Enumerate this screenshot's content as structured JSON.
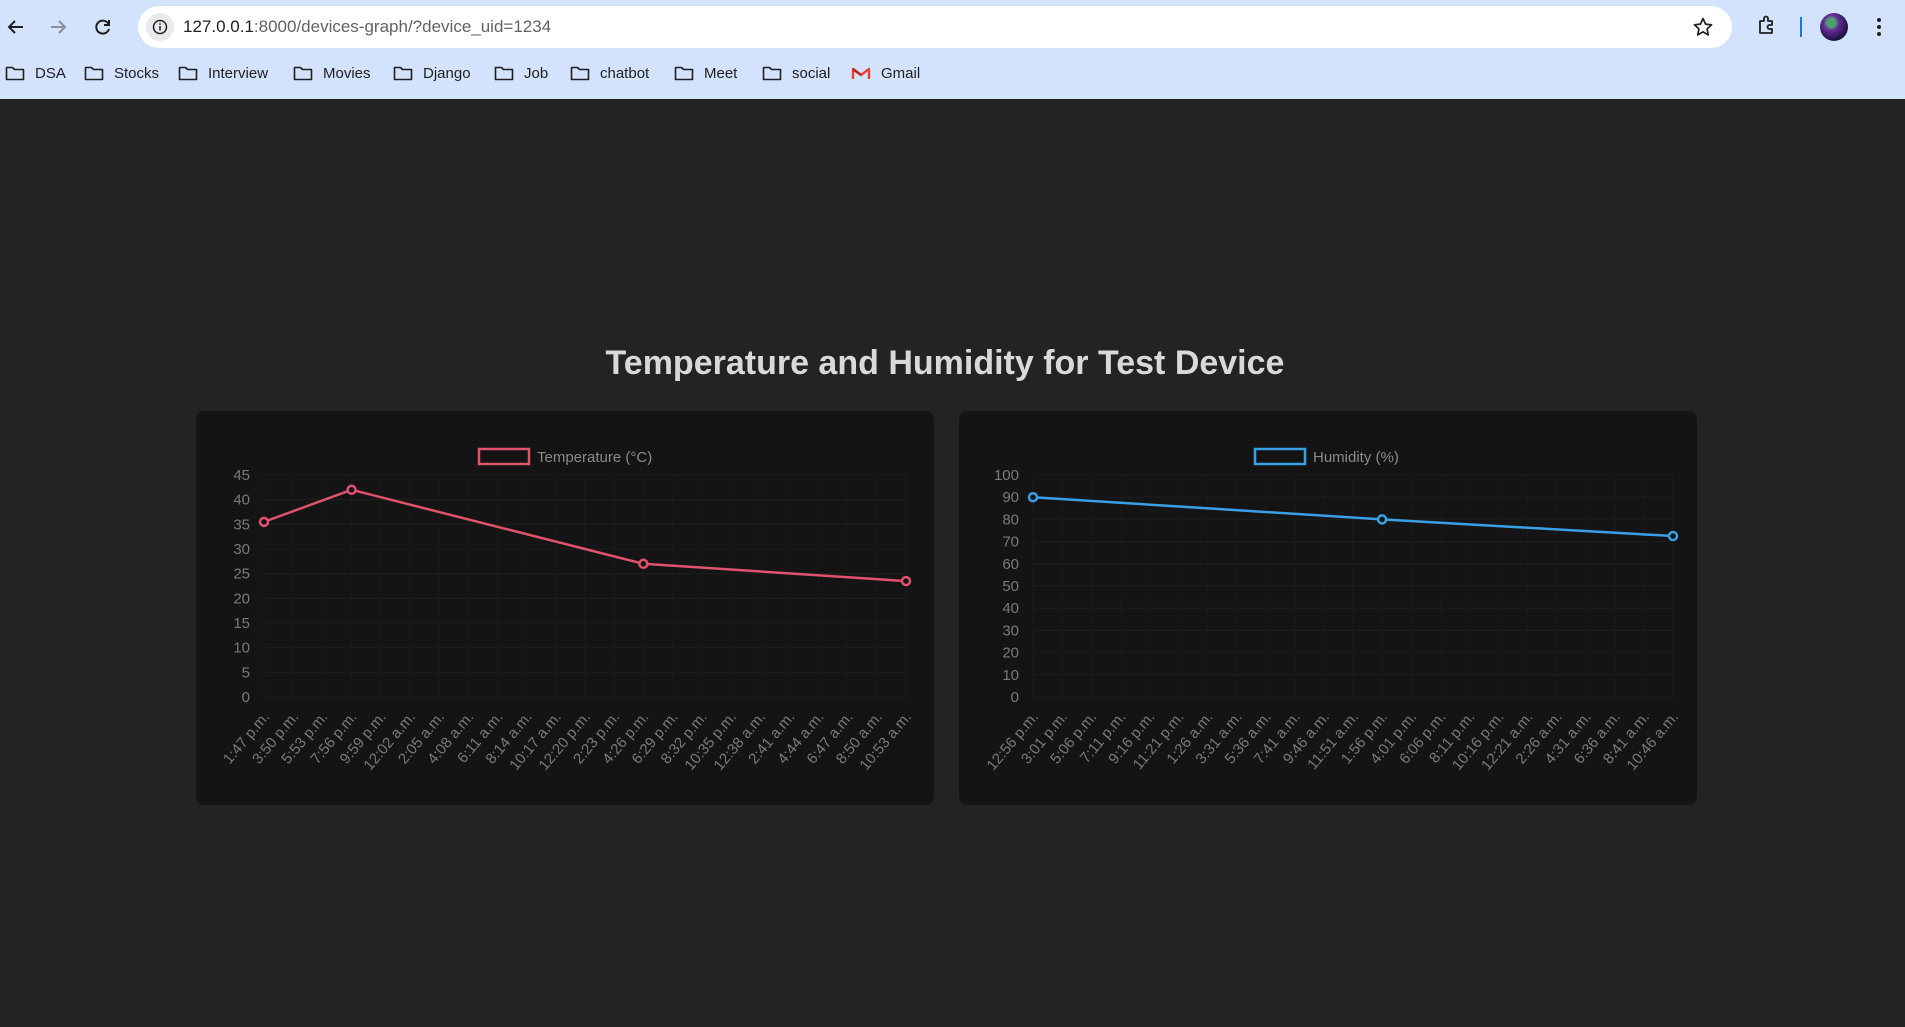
{
  "browser": {
    "url_host": "127.0.0.1",
    "url_path": ":8000/devices-graph/?device_uid=1234",
    "bookmarks": [
      {
        "label": "DSA",
        "icon": "folder-icon"
      },
      {
        "label": "Stocks",
        "icon": "folder-icon"
      },
      {
        "label": "Interview",
        "icon": "folder-icon"
      },
      {
        "label": "Movies",
        "icon": "folder-icon"
      },
      {
        "label": "Django",
        "icon": "folder-icon"
      },
      {
        "label": "Job",
        "icon": "folder-icon"
      },
      {
        "label": "chatbot",
        "icon": "folder-icon"
      },
      {
        "label": "Meet",
        "icon": "folder-icon"
      },
      {
        "label": "social",
        "icon": "folder-icon"
      },
      {
        "label": "Gmail",
        "icon": "gmail-icon"
      }
    ]
  },
  "page": {
    "title": "Temperature and Humidity for Test Device"
  },
  "chart_data": [
    {
      "type": "line",
      "legend": "Temperature (°C)",
      "color": "#e0526d",
      "legend_position": "top-center",
      "grid": true,
      "ylim": [
        0,
        45
      ],
      "yticks": [
        0,
        5,
        10,
        15,
        20,
        25,
        30,
        35,
        40,
        45
      ],
      "categories": [
        "1:47 p.m.",
        "3:50 p.m.",
        "5:53 p.m.",
        "7:56 p.m.",
        "9:59 p.m.",
        "12:02 a.m.",
        "2:05 a.m.",
        "4:08 a.m.",
        "6:11 a.m.",
        "8:14 a.m.",
        "10:17 a.m.",
        "12:20 p.m.",
        "2:23 p.m.",
        "4:26 p.m.",
        "6:29 p.m.",
        "8:32 p.m.",
        "10:35 p.m.",
        "12:38 a.m.",
        "2:41 a.m.",
        "4:44 a.m.",
        "6:47 a.m.",
        "8:50 a.m.",
        "10:53 a.m."
      ],
      "points": [
        {
          "x": "1:47 p.m.",
          "y": 35.5
        },
        {
          "x": "7:56 p.m.",
          "y": 42
        },
        {
          "x": "4:26 p.m.",
          "y": 27
        },
        {
          "x": "10:53 a.m.",
          "y": 23.5
        }
      ]
    },
    {
      "type": "line",
      "legend": "Humidity (%)",
      "color": "#3aa0e6",
      "legend_position": "top-center",
      "grid": true,
      "ylim": [
        0,
        100
      ],
      "yticks": [
        0,
        10,
        20,
        30,
        40,
        50,
        60,
        70,
        80,
        90,
        100
      ],
      "categories": [
        "12:56 p.m.",
        "3:01 p.m.",
        "5:06 p.m.",
        "7:11 p.m.",
        "9:16 p.m.",
        "11:21 p.m.",
        "1:26 a.m.",
        "3:31 a.m.",
        "5:36 a.m.",
        "7:41 a.m.",
        "9:46 a.m.",
        "11:51 a.m.",
        "1:56 p.m.",
        "4:01 p.m.",
        "6:06 p.m.",
        "8:11 p.m.",
        "10:16 p.m.",
        "12:21 a.m.",
        "2:26 a.m.",
        "4:31 a.m.",
        "6:36 a.m.",
        "8:41 a.m.",
        "10:46 a.m."
      ],
      "points": [
        {
          "x": "12:56 p.m.",
          "y": 90
        },
        {
          "x": "1:56 p.m.",
          "y": 80
        },
        {
          "x": "10:46 a.m.",
          "y": 72.5
        }
      ]
    }
  ]
}
